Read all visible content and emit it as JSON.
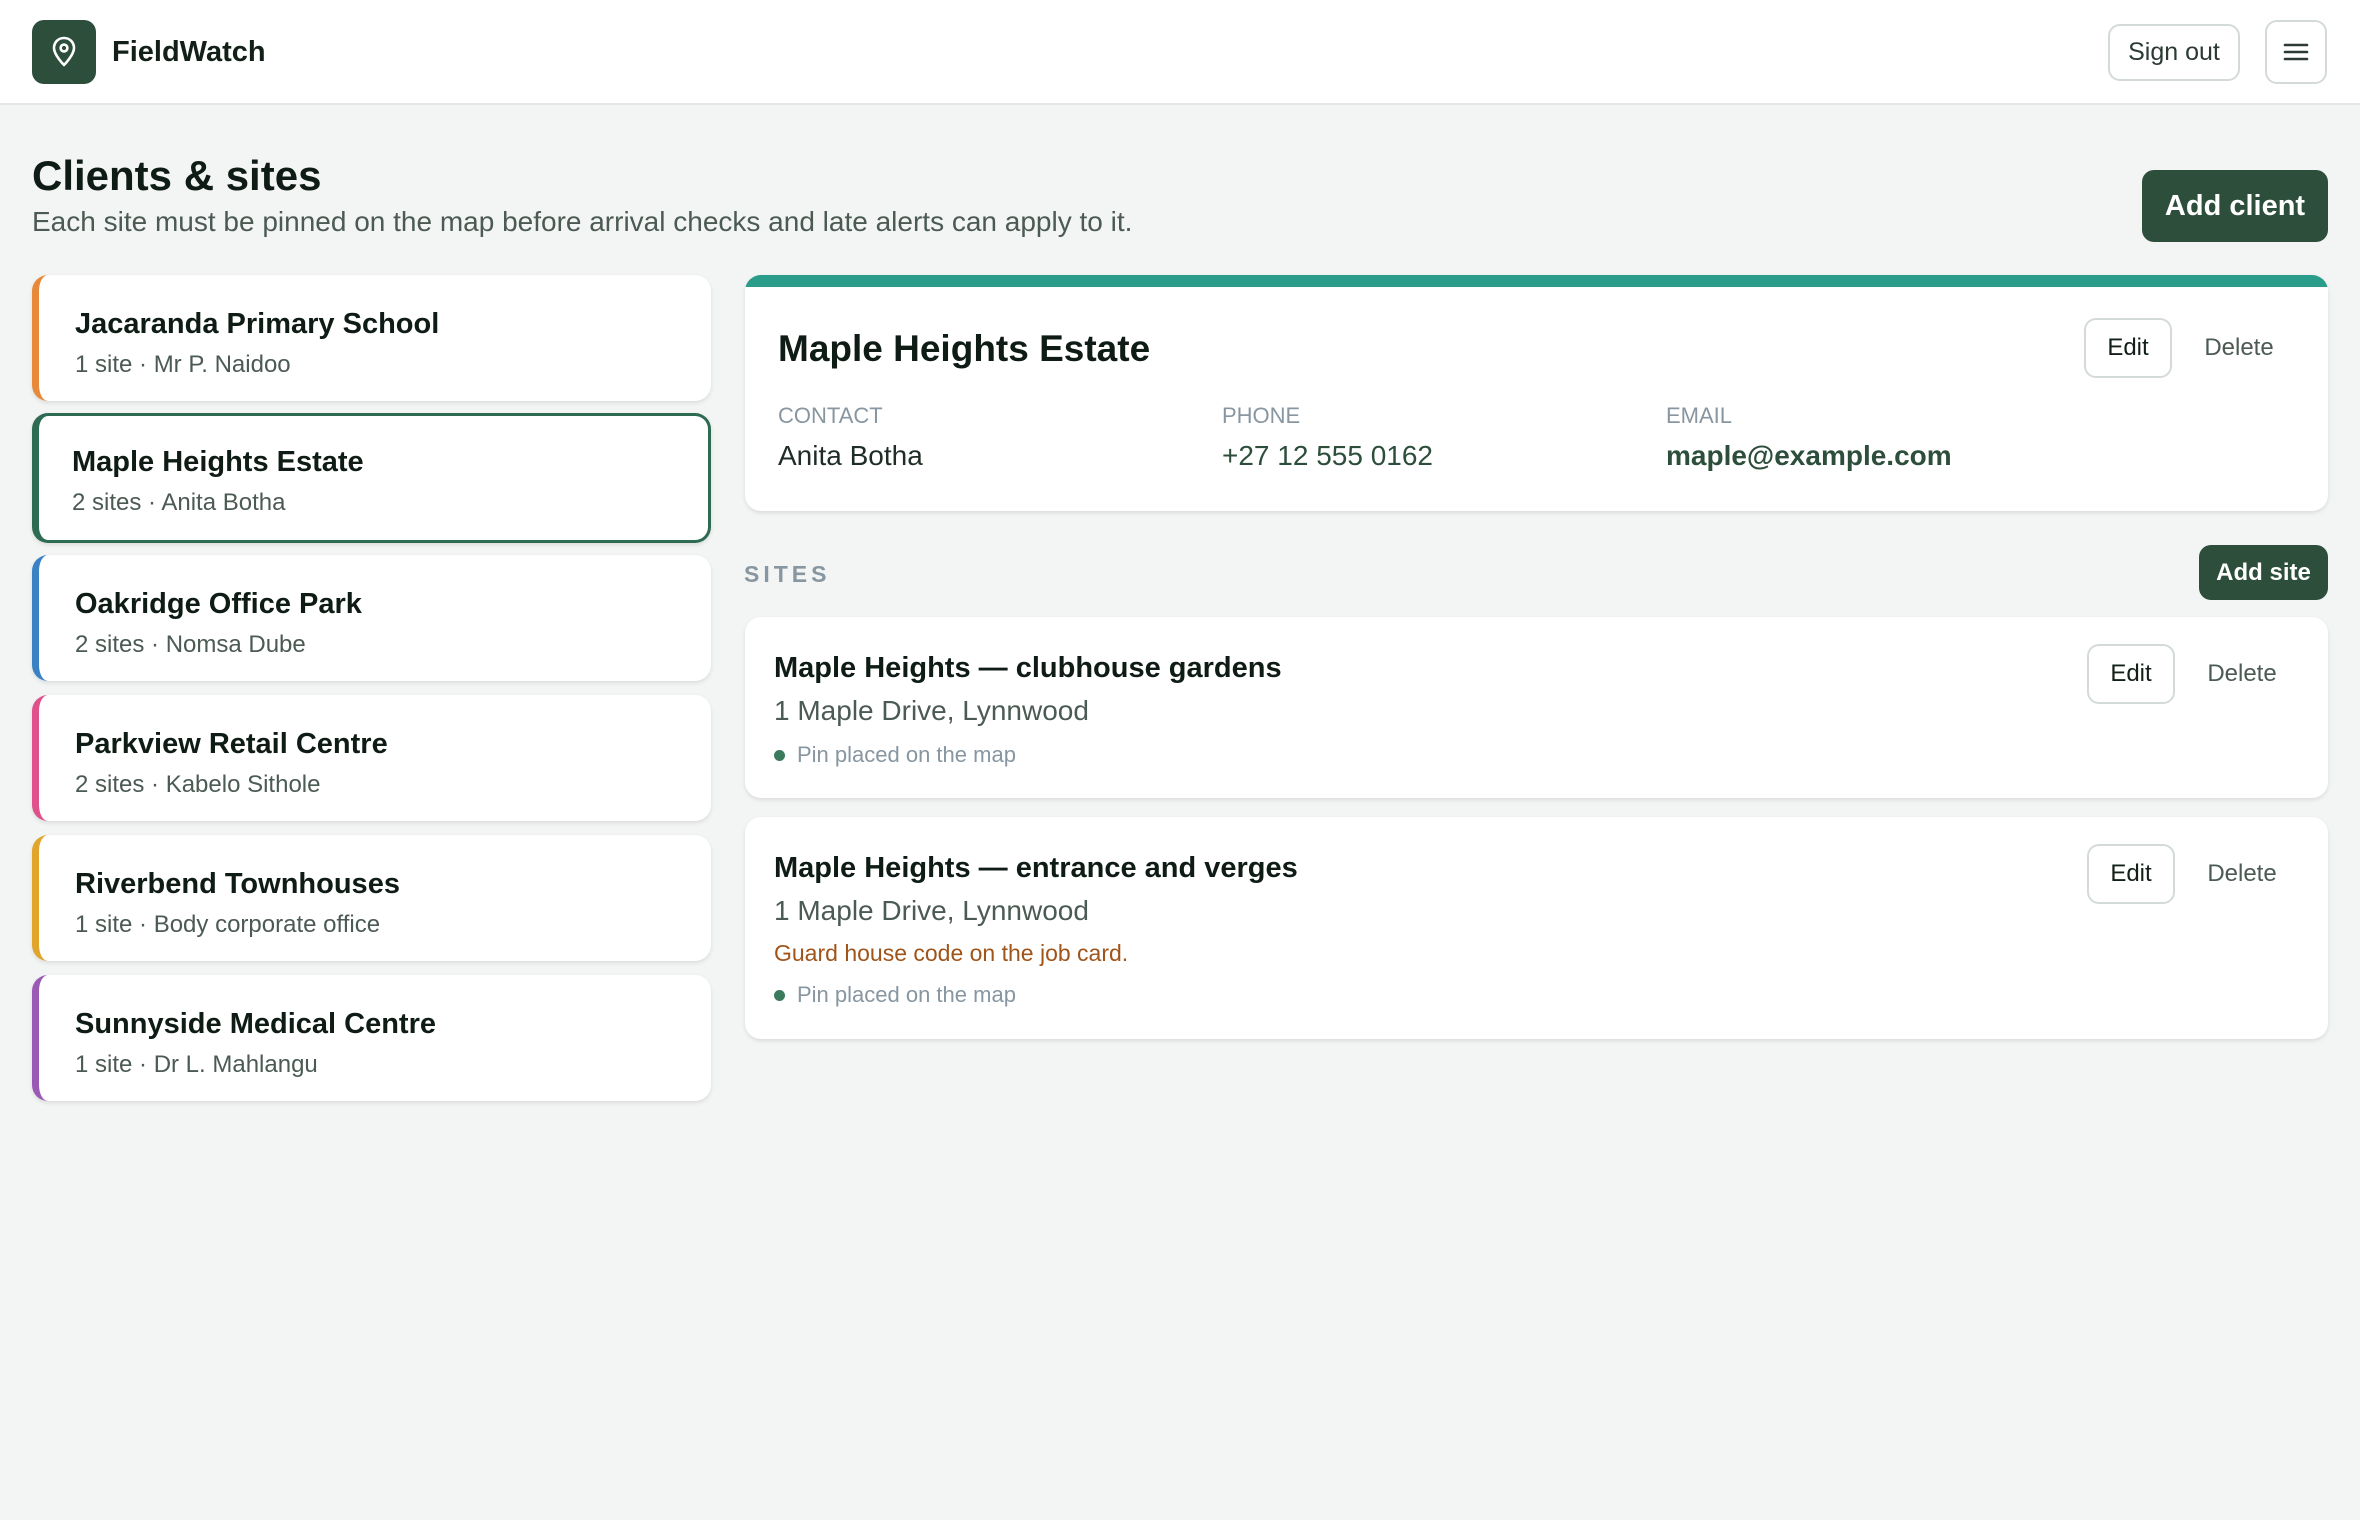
{
  "app": {
    "name": "FieldWatch",
    "logo_icon": "map-pin-icon",
    "sign_out_label": "Sign out",
    "menu_icon": "hamburger-menu-icon"
  },
  "page": {
    "title": "Clients & sites",
    "subtitle": "Each site must be pinned on the map before arrival checks and late alerts can apply to it.",
    "add_client_label": "Add client"
  },
  "clients": [
    {
      "name": "Jacaranda Primary School",
      "meta": "1 site · Mr P. Naidoo",
      "accent": "#e8893a",
      "selected": false
    },
    {
      "name": "Maple Heights Estate",
      "meta": "2 sites · Anita Botha",
      "accent": "#2d6b52",
      "selected": true
    },
    {
      "name": "Oakridge Office Park",
      "meta": "2 sites · Nomsa Dube",
      "accent": "#3b82c4",
      "selected": false
    },
    {
      "name": "Parkview Retail Centre",
      "meta": "2 sites · Kabelo Sithole",
      "accent": "#e0508a",
      "selected": false
    },
    {
      "name": "Riverbend Townhouses",
      "meta": "1 site · Body corporate office",
      "accent": "#e0a52a",
      "selected": false
    },
    {
      "name": "Sunnyside Medical Centre",
      "meta": "1 site · Dr L. Mahlangu",
      "accent": "#9b59b6",
      "selected": false
    }
  ],
  "detail": {
    "title": "Maple Heights Estate",
    "accent": "#2a9d8a",
    "edit_label": "Edit",
    "delete_label": "Delete",
    "contact_label": "Contact",
    "contact_value": "Anita Botha",
    "phone_label": "Phone",
    "phone_value": "+27 12 555 0162",
    "email_label": "Email",
    "email_value": "maple@example.com"
  },
  "sites": {
    "heading": "SITES",
    "add_site_label": "Add site",
    "items": [
      {
        "name": "Maple Heights — clubhouse gardens",
        "address": "1 Maple Drive, Lynnwood",
        "note": "",
        "pin_status": "Pin placed on the map",
        "edit_label": "Edit",
        "delete_label": "Delete"
      },
      {
        "name": "Maple Heights — entrance and verges",
        "address": "1 Maple Drive, Lynnwood",
        "note": "Guard house code on the job card.",
        "pin_status": "Pin placed on the map",
        "edit_label": "Edit",
        "delete_label": "Delete"
      }
    ]
  }
}
